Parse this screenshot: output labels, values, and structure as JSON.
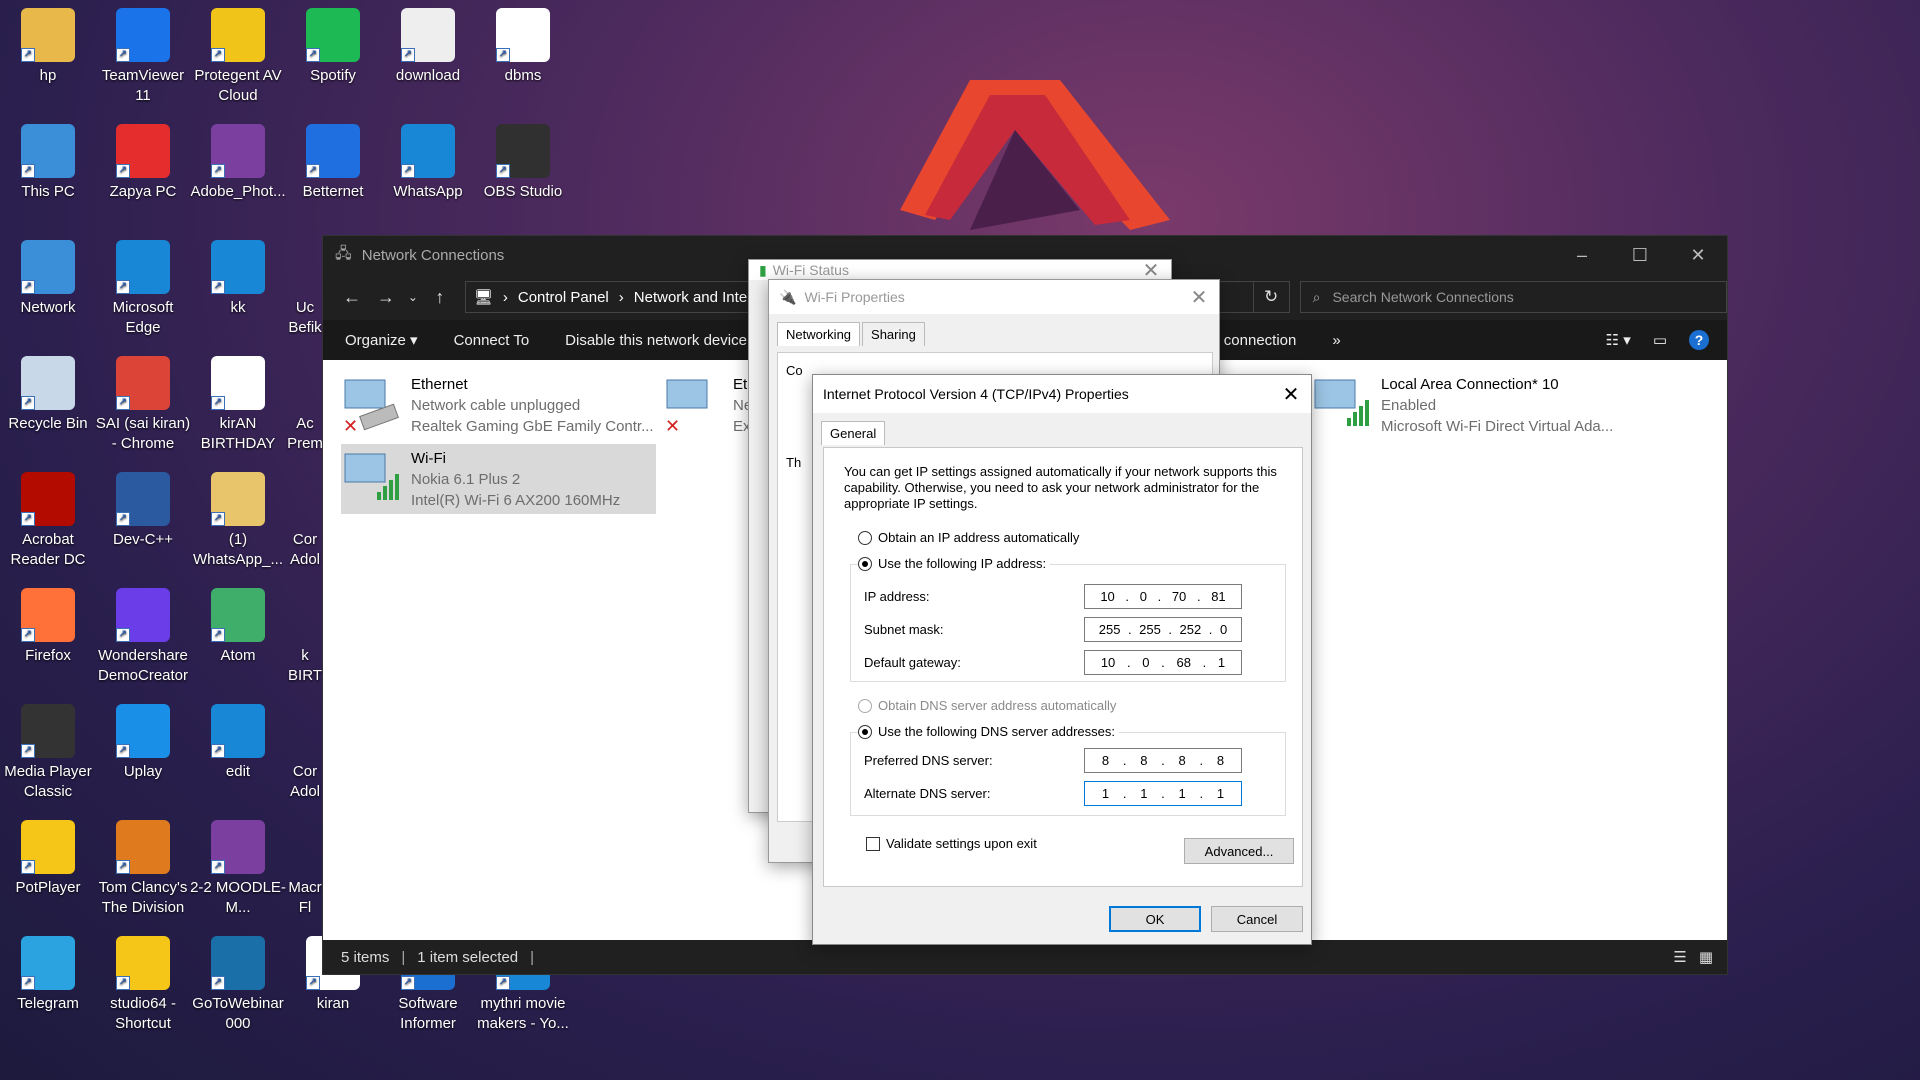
{
  "desktop": {
    "icons": [
      {
        "label": "hp",
        "icon": "folder-icon",
        "color": "#e8b94a"
      },
      {
        "label": "TeamViewer 11",
        "icon": "teamviewer-icon",
        "color": "#1a73e8"
      },
      {
        "label": "Protegent AV Cloud",
        "icon": "protegent-icon",
        "color": "#f0c419"
      },
      {
        "label": "Spotify",
        "icon": "spotify-icon",
        "color": "#1db954"
      },
      {
        "label": "download",
        "icon": "file-icon",
        "color": "#eeeeee"
      },
      {
        "label": "dbms",
        "icon": "file-icon",
        "color": "#ffffff"
      },
      {
        "label": "This PC",
        "icon": "computer-icon",
        "color": "#3a8fd8"
      },
      {
        "label": "Zapya PC",
        "icon": "zapya-icon",
        "color": "#e52d2d"
      },
      {
        "label": "Adobe_Phot...",
        "icon": "winrar-icon",
        "color": "#7b3fa0"
      },
      {
        "label": "Betternet",
        "icon": "betternet-icon",
        "color": "#1f6fe0"
      },
      {
        "label": "WhatsApp",
        "icon": "edge-icon",
        "color": "#1787d6"
      },
      {
        "label": "OBS Studio",
        "icon": "obs-icon",
        "color": "#303030"
      },
      {
        "label": "Network",
        "icon": "network-icon",
        "color": "#3a8fd8"
      },
      {
        "label": "Microsoft Edge",
        "icon": "edge-icon",
        "color": "#1787d6"
      },
      {
        "label": "kk",
        "icon": "edge-icon",
        "color": "#1787d6"
      },
      {
        "label": "Recycle Bin",
        "icon": "recycle-bin-icon",
        "color": "#c8d8e8"
      },
      {
        "label": "SAI (sai kiran) - Chrome",
        "icon": "chrome-icon",
        "color": "#db4437"
      },
      {
        "label": "kirAN BIRTHDAY",
        "icon": "file-icon",
        "color": "#ffffff"
      },
      {
        "label": "Acrobat Reader DC",
        "icon": "acrobat-icon",
        "color": "#b30b00"
      },
      {
        "label": "Dev-C++",
        "icon": "devcpp-icon",
        "color": "#2c5aa0"
      },
      {
        "label": "(1) WhatsApp_...",
        "icon": "folder-icon",
        "color": "#e8c56a"
      },
      {
        "label": "Firefox",
        "icon": "firefox-icon",
        "color": "#ff7139"
      },
      {
        "label": "Wondershare DemoCreator",
        "icon": "democreator-icon",
        "color": "#6a3de8"
      },
      {
        "label": "Atom",
        "icon": "atom-icon",
        "color": "#3fae6a"
      },
      {
        "label": "Media Player Classic",
        "icon": "mpc-icon",
        "color": "#333333"
      },
      {
        "label": "Uplay",
        "icon": "uplay-icon",
        "color": "#1a8fe8"
      },
      {
        "label": "edit",
        "icon": "edge-icon",
        "color": "#1787d6"
      },
      {
        "label": "PotPlayer",
        "icon": "potplayer-icon",
        "color": "#f5c518"
      },
      {
        "label": "Tom Clancy's The Division",
        "icon": "division-icon",
        "color": "#e07a1f"
      },
      {
        "label": "2-2 MOODLE-M...",
        "icon": "winrar-icon",
        "color": "#7b3fa0"
      },
      {
        "label": "Telegram",
        "icon": "telegram-icon",
        "color": "#2aa3e0"
      },
      {
        "label": "studio64 - Shortcut",
        "icon": "android-studio-icon",
        "color": "#f5c518"
      },
      {
        "label": "GoToWebinar 000",
        "icon": "gotowebinar-icon",
        "color": "#1a6fa8"
      },
      {
        "label": "kiran",
        "icon": "file-icon",
        "color": "#ffffff"
      },
      {
        "label": "Software Informer",
        "icon": "software-informer-icon",
        "color": "#1a6fd0"
      },
      {
        "label": "mythri movie makers - Yo...",
        "icon": "edge-icon",
        "color": "#1787d6"
      }
    ],
    "partial_icons": [
      "Uc Befik",
      "Ac Prem",
      "Cor Adol",
      "k BIRT",
      "Cor Adol",
      "Macr Fl"
    ]
  },
  "explorer": {
    "title": "Network Connections",
    "breadcrumb": [
      "Control Panel",
      "Network and Intern"
    ],
    "search_placeholder": "Search Network Connections",
    "commands": [
      "Organize ▾",
      "Connect To",
      "Disable this network device"
    ],
    "command_partial": "tatus of this connection",
    "connections": [
      {
        "name": "Ethernet",
        "status": "Network cable unplugged",
        "adapter": "Realtek Gaming GbE Family Contr...",
        "error": true
      },
      {
        "name": "Wi-Fi",
        "status": "Nokia 6.1 Plus 2",
        "adapter": "Intel(R) Wi-Fi 6 AX200 160MHz",
        "selected": true
      },
      {
        "name": "Eth",
        "status": "Ne",
        "adapter": "Exp",
        "error": true
      },
      {
        "name": "Local Area Connection* 10",
        "status": "Enabled",
        "adapter": "Microsoft Wi-Fi Direct Virtual Ada..."
      }
    ],
    "status_bar": {
      "items": "5 items",
      "selected": "1 item selected"
    }
  },
  "wifi_status": {
    "title": "Wi-Fi Status"
  },
  "wifi_properties": {
    "title": "Wi-Fi Properties",
    "tabs": [
      "Networking",
      "Sharing"
    ],
    "partial_labels": [
      "Co",
      "Th"
    ]
  },
  "ipv4": {
    "title": "Internet Protocol Version 4 (TCP/IPv4) Properties",
    "tab": "General",
    "intro": "You can get IP settings assigned automatically if your network supports this capability. Otherwise, you need to ask your network administrator for the appropriate IP settings.",
    "obtain_ip_auto": "Obtain an IP address automatically",
    "use_following_ip": "Use the following IP address:",
    "ip_label": "IP address:",
    "ip": [
      "10",
      "0",
      "70",
      "81"
    ],
    "subnet_label": "Subnet mask:",
    "subnet": [
      "255",
      "255",
      "252",
      "0"
    ],
    "gateway_label": "Default gateway:",
    "gateway": [
      "10",
      "0",
      "68",
      "1"
    ],
    "obtain_dns_auto": "Obtain DNS server address automatically",
    "use_following_dns": "Use the following DNS server addresses:",
    "pref_dns_label": "Preferred DNS server:",
    "pref_dns": [
      "8",
      "8",
      "8",
      "8"
    ],
    "alt_dns_label": "Alternate DNS server:",
    "alt_dns": [
      "1",
      "1",
      "1",
      "1"
    ],
    "validate": "Validate settings upon exit",
    "advanced": "Advanced...",
    "ok": "OK",
    "cancel": "Cancel"
  }
}
